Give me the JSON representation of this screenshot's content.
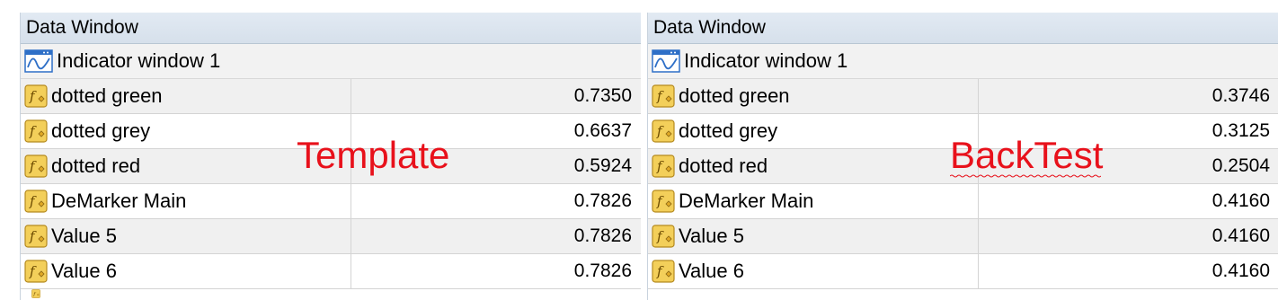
{
  "panels": [
    {
      "title": "Data Window",
      "group_label": "Indicator window 1",
      "rows": [
        {
          "label": "dotted green",
          "value": "0.7350"
        },
        {
          "label": "dotted grey",
          "value": "0.6637"
        },
        {
          "label": "dotted red",
          "value": "0.5924"
        },
        {
          "label": "DeMarker Main",
          "value": "0.7826"
        },
        {
          "label": "Value 5",
          "value": "0.7826"
        },
        {
          "label": "Value 6",
          "value": "0.7826"
        }
      ]
    },
    {
      "title": "Data Window",
      "group_label": "Indicator window 1",
      "rows": [
        {
          "label": "dotted green",
          "value": "0.3746"
        },
        {
          "label": "dotted grey",
          "value": "0.3125"
        },
        {
          "label": "dotted red",
          "value": "0.2504"
        },
        {
          "label": "DeMarker Main",
          "value": "0.4160"
        },
        {
          "label": "Value 5",
          "value": "0.4160"
        },
        {
          "label": "Value 6",
          "value": "0.4160"
        }
      ]
    }
  ],
  "annotations": {
    "left": "Template",
    "right": "BackTest"
  },
  "colors": {
    "annotation": "#e8111b",
    "title_bar": "#dbe4ee",
    "icon_fill": "#f3cf5a"
  },
  "icons": {
    "group": "indicator-window-icon",
    "row": "function-icon"
  }
}
